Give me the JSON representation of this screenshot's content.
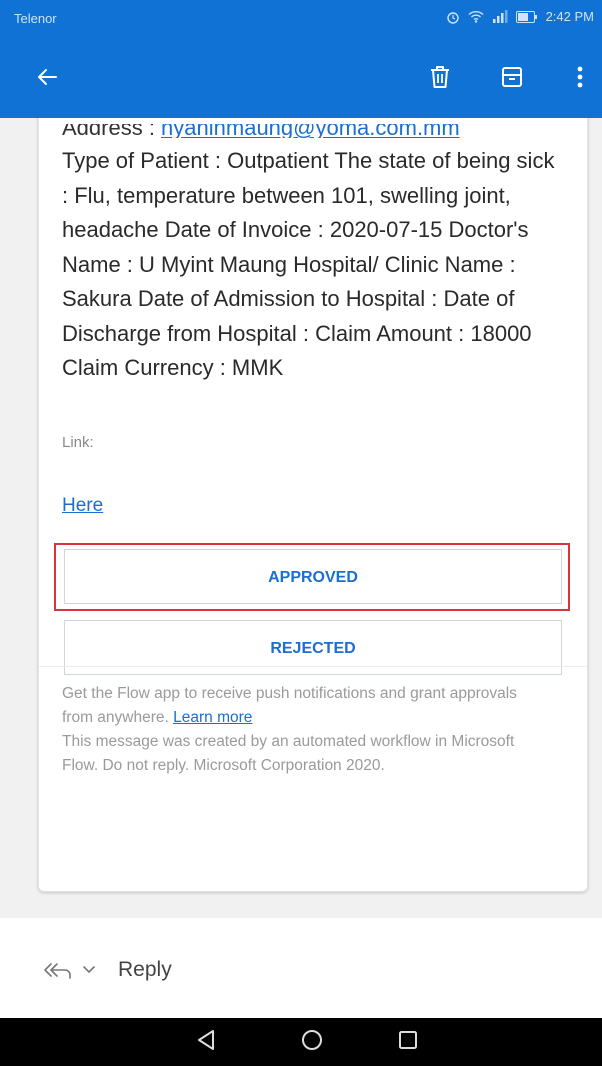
{
  "status_bar": {
    "carrier": "Telenor",
    "time": "2:42 PM"
  },
  "toolbar": {
    "back_icon": "arrow-left-icon",
    "delete_icon": "trash-icon",
    "archive_icon": "archive-icon",
    "more_icon": "more-vertical-icon"
  },
  "email": {
    "address_label": "Address : ",
    "address_value": "nyaninmaung@yoma.com.mm",
    "body": "Type of Patient : Outpatient    The state of being sick : Flu, temperature between 101, swelling joint, headache    Date of Invoice : 2020-07-15    Doctor's Name : U Myint Maung    Hospital/ Clinic Name : Sakura    Date of Admission to Hospital :    Date of Discharge from Hospital :    Claim Amount : 18000    Claim Currency : MMK",
    "link_label": "Link:",
    "link_text": "Here",
    "approve_label": "APPROVED",
    "reject_label": "REJECTED",
    "footer_line1": "Get the Flow app to receive push notifications and grant approvals from anywhere. ",
    "footer_learn_more": "Learn more",
    "footer_line2": "This message was created by an automated workflow in Microsoft Flow. Do not reply. Microsoft Corporation 2020."
  },
  "reply": {
    "label": "Reply",
    "icon": "reply-all-icon"
  },
  "colors": {
    "toolbar": "#0f72d4",
    "link": "#1a6fd0",
    "highlight": "#d9343e"
  }
}
